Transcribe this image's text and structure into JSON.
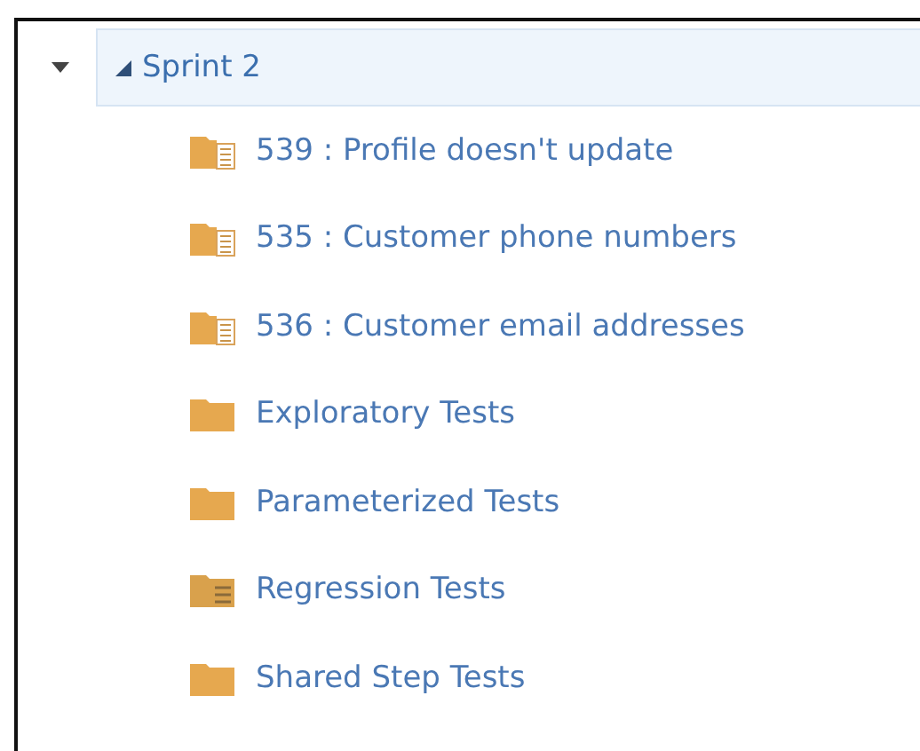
{
  "tree": {
    "label": "Sprint 2",
    "expanded": true,
    "selected": true,
    "children": [
      {
        "label": "539 : Profile doesn't update",
        "kind": "requirement",
        "selected": false
      },
      {
        "label": "535 : Customer phone numbers",
        "kind": "requirement",
        "selected": false
      },
      {
        "label": "536 : Customer email addresses",
        "kind": "requirement",
        "selected": false
      },
      {
        "label": "Exploratory Tests",
        "kind": "static",
        "selected": false
      },
      {
        "label": "Parameterized Tests",
        "kind": "static",
        "selected": false
      },
      {
        "label": "Regression Tests",
        "kind": "query",
        "selected": false
      },
      {
        "label": "Shared Step Tests",
        "kind": "static",
        "selected": false
      }
    ]
  }
}
